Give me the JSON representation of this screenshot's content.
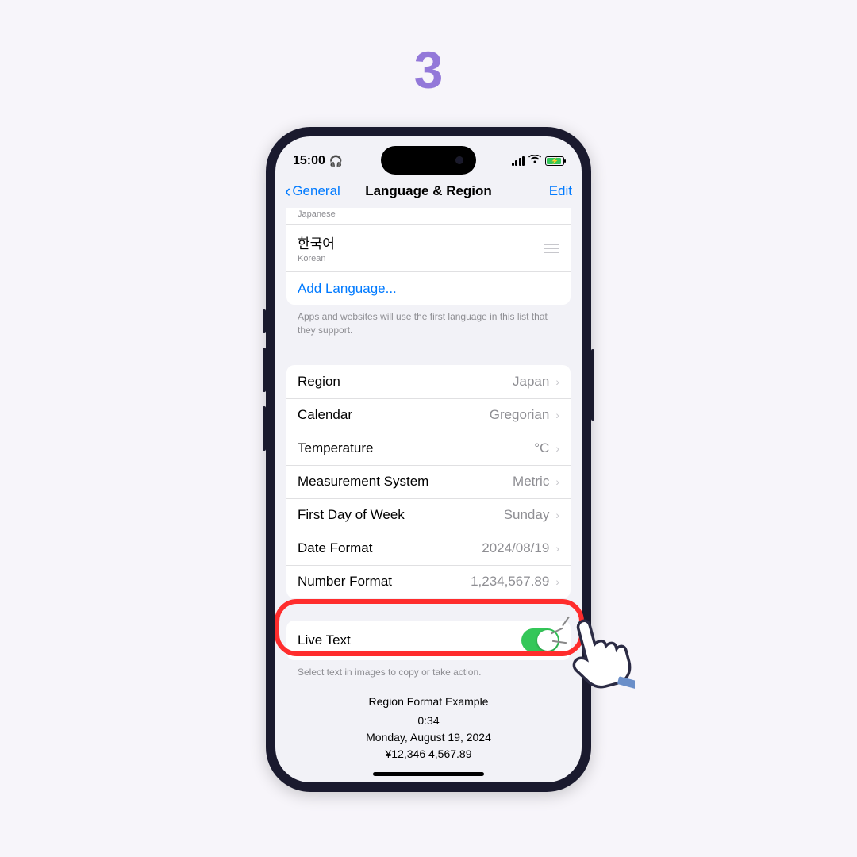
{
  "step": "3",
  "status": {
    "time": "15:00"
  },
  "nav": {
    "back": "General",
    "title": "Language & Region",
    "edit": "Edit"
  },
  "languages": {
    "partial_sub": "Japanese",
    "korean": {
      "native": "한국어",
      "english": "Korean"
    },
    "add": "Add Language..."
  },
  "lang_footer": "Apps and websites will use the first language in this list that they support.",
  "settings": {
    "region": {
      "label": "Region",
      "value": "Japan"
    },
    "calendar": {
      "label": "Calendar",
      "value": "Gregorian"
    },
    "temperature": {
      "label": "Temperature",
      "value": "°C"
    },
    "measurement": {
      "label": "Measurement System",
      "value": "Metric"
    },
    "firstday": {
      "label": "First Day of Week",
      "value": "Sunday"
    },
    "dateformat": {
      "label": "Date Format",
      "value": "2024/08/19"
    },
    "numberformat": {
      "label": "Number Format",
      "value": "1,234,567.89"
    }
  },
  "livetext": {
    "label": "Live Text",
    "footer": "Select text in images to copy or take action."
  },
  "example": {
    "title": "Region Format Example",
    "time": "0:34",
    "date": "Monday, August 19, 2024",
    "currency": "¥12,346   4,567.89"
  }
}
